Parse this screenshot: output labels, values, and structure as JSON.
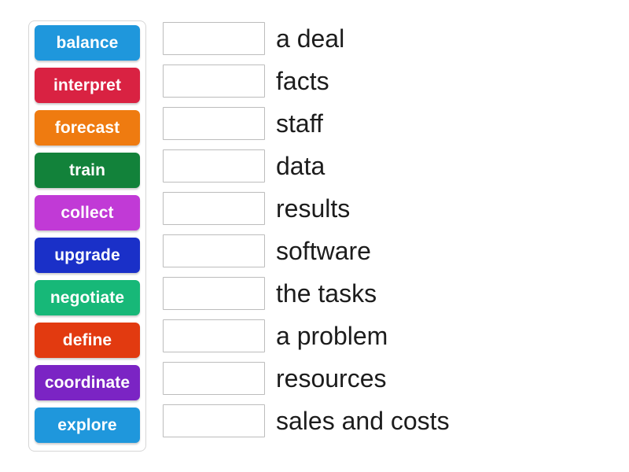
{
  "activity": {
    "type": "match-up",
    "tile_text_color": "#ffffff",
    "row_text_color": "#1c1c1c",
    "dropzone_border_color": "#bcbcbc",
    "panel_border_color": "#d6d6d6",
    "background_color": "#ffffff"
  },
  "tiles": [
    {
      "label": "balance",
      "color": "#1f97dc"
    },
    {
      "label": "interpret",
      "color": "#d92242"
    },
    {
      "label": "forecast",
      "color": "#ef7b10"
    },
    {
      "label": "train",
      "color": "#12823a"
    },
    {
      "label": "collect",
      "color": "#c13ad6"
    },
    {
      "label": "upgrade",
      "color": "#1a30c8"
    },
    {
      "label": "negotiate",
      "color": "#17b878"
    },
    {
      "label": "define",
      "color": "#e23a10"
    },
    {
      "label": "coordinate",
      "color": "#7b24c4"
    },
    {
      "label": "explore",
      "color": "#1f97dc"
    }
  ],
  "rows": [
    {
      "answer": "",
      "text": "a deal"
    },
    {
      "answer": "",
      "text": "facts"
    },
    {
      "answer": "",
      "text": "staff"
    },
    {
      "answer": "",
      "text": "data"
    },
    {
      "answer": "",
      "text": "results"
    },
    {
      "answer": "",
      "text": "software"
    },
    {
      "answer": "",
      "text": "the tasks"
    },
    {
      "answer": "",
      "text": "a problem"
    },
    {
      "answer": "",
      "text": "resources"
    },
    {
      "answer": "",
      "text": "sales and costs"
    }
  ]
}
